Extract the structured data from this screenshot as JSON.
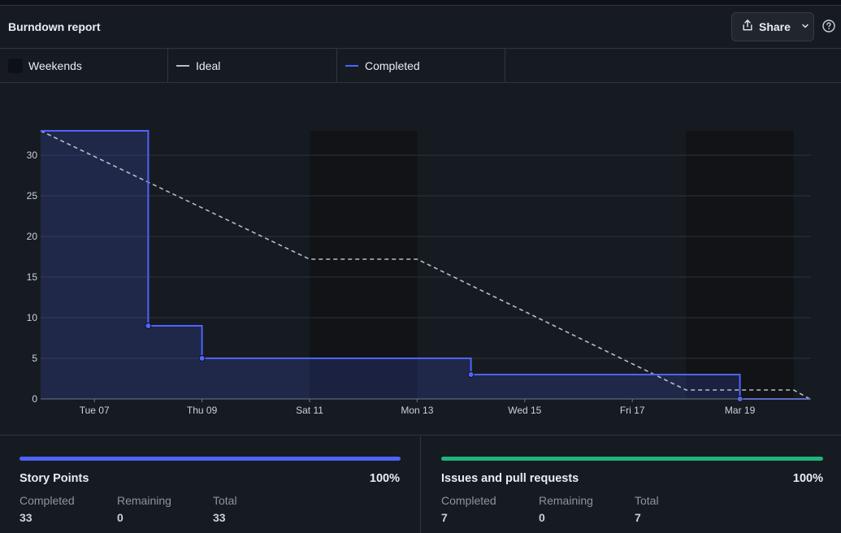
{
  "header": {
    "title": "Burndown report",
    "share_label": "Share"
  },
  "legend": {
    "weekends": "Weekends",
    "ideal": "Ideal",
    "completed": "Completed"
  },
  "colors": {
    "completed": "#4f63ff",
    "ideal": "#b8bec6",
    "weekend_band": "#111316",
    "story_bar": "#4f63ff",
    "issues_bar": "#1fb57a"
  },
  "chart_data": {
    "type": "line",
    "x_ticks": [
      "Tue 07",
      "Thu 09",
      "Sat 11",
      "Mon 13",
      "Wed 15",
      "Fri 17",
      "Mar 19"
    ],
    "ylim": [
      0,
      33
    ],
    "yticks": [
      0,
      5,
      10,
      15,
      20,
      25,
      30
    ],
    "grid": true,
    "legend_position": "top",
    "weekend_bands": [
      [
        5,
        7
      ],
      [
        12,
        14
      ]
    ],
    "series": [
      {
        "name": "Ideal",
        "style": "dashed",
        "points": [
          [
            0,
            33
          ],
          [
            5,
            17.2
          ],
          [
            7,
            17.2
          ],
          [
            12,
            1.1
          ],
          [
            14,
            1.1
          ],
          [
            14.3,
            0
          ]
        ]
      },
      {
        "name": "Completed",
        "style": "step",
        "points": [
          [
            0,
            33
          ],
          [
            2,
            9
          ],
          [
            3,
            5
          ],
          [
            8,
            3
          ],
          [
            13,
            0
          ],
          [
            14.3,
            0
          ]
        ]
      }
    ]
  },
  "stats": {
    "story": {
      "title": "Story Points",
      "percent": "100%",
      "completed_label": "Completed",
      "remaining_label": "Remaining",
      "total_label": "Total",
      "completed": "33",
      "remaining": "0",
      "total": "33"
    },
    "issues": {
      "title": "Issues and pull requests",
      "percent": "100%",
      "completed_label": "Completed",
      "remaining_label": "Remaining",
      "total_label": "Total",
      "completed": "7",
      "remaining": "0",
      "total": "7"
    }
  }
}
